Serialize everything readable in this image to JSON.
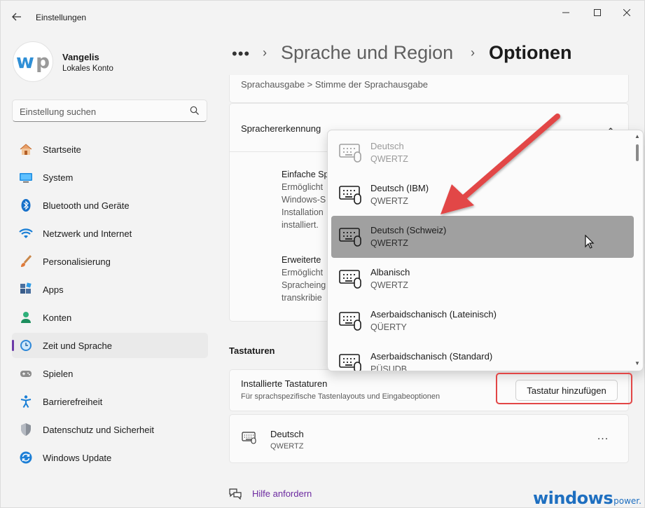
{
  "window": {
    "title": "Einstellungen",
    "back_icon": "back-arrow-icon",
    "minimize_icon": "minimize-icon",
    "maximize_icon": "maximize-icon",
    "close_icon": "close-icon"
  },
  "profile": {
    "name": "Vangelis",
    "account_type": "Lokales Konto",
    "avatar_text": "wp"
  },
  "search": {
    "placeholder": "Einstellung suchen",
    "icon": "search-icon"
  },
  "sidebar": {
    "items": [
      {
        "label": "Startseite",
        "icon": "home-icon"
      },
      {
        "label": "System",
        "icon": "monitor-icon"
      },
      {
        "label": "Bluetooth und Geräte",
        "icon": "bluetooth-icon"
      },
      {
        "label": "Netzwerk und Internet",
        "icon": "wifi-icon"
      },
      {
        "label": "Personalisierung",
        "icon": "brush-icon"
      },
      {
        "label": "Apps",
        "icon": "apps-icon"
      },
      {
        "label": "Konten",
        "icon": "person-icon"
      },
      {
        "label": "Zeit und Sprache",
        "icon": "clock-globe-icon",
        "active": true
      },
      {
        "label": "Spielen",
        "icon": "gamepad-icon"
      },
      {
        "label": "Barrierefreiheit",
        "icon": "accessibility-icon"
      },
      {
        "label": "Datenschutz und Sicherheit",
        "icon": "shield-icon"
      },
      {
        "label": "Windows Update",
        "icon": "update-icon"
      }
    ]
  },
  "breadcrumb": {
    "more": "•••",
    "separator": "›",
    "parent": "Sprache und Region",
    "current": "Optionen"
  },
  "main": {
    "top_card_text": "Sprachausgabe > Stimme der Sprachausgabe",
    "speech_recognition": {
      "title": "Sprachererkennung",
      "options": [
        {
          "heading": "Einfache Sp",
          "lines": [
            "Ermöglicht",
            "Windows-S",
            "Installation",
            "installiert."
          ]
        },
        {
          "heading": "Erweiterte",
          "lines": [
            "Ermöglicht",
            "Spracheing",
            "transkribie"
          ]
        }
      ]
    },
    "keyboards_section": "Tastaturen",
    "installed_keyboards": {
      "title": "Installierte Tastaturen",
      "description": "Für sprachspezifische Tastenlayouts und Eingabeoptionen",
      "add_button": "Tastatur hinzufügen"
    },
    "keyboard_entry": {
      "name": "Deutsch",
      "layout": "QWERTZ",
      "more": "..."
    },
    "help_link": "Hilfe anfordern"
  },
  "dropdown": {
    "items": [
      {
        "name": "Deutsch",
        "layout": "QWERTZ",
        "state": "disabled"
      },
      {
        "name": "Deutsch (IBM)",
        "layout": "QWERTZ"
      },
      {
        "name": "Deutsch (Schweiz)",
        "layout": "QWERTZ",
        "state": "hover"
      },
      {
        "name": "Albanisch",
        "layout": "QWERTZ"
      },
      {
        "name": "Aserbaidschanisch (Lateinisch)",
        "layout": "QÜERTY"
      },
      {
        "name": "Aserbaidschanisch (Standard)",
        "layout": "PÜSUDB"
      }
    ]
  },
  "annotations": {
    "arrow_color": "#e24646",
    "highlight_color": "#e24646"
  },
  "watermark": {
    "main": "windows",
    "sub": "power."
  },
  "colors": {
    "accent": "#6c3aa8",
    "link": "#6c2aa0",
    "watermark": "#1e6fc0"
  }
}
